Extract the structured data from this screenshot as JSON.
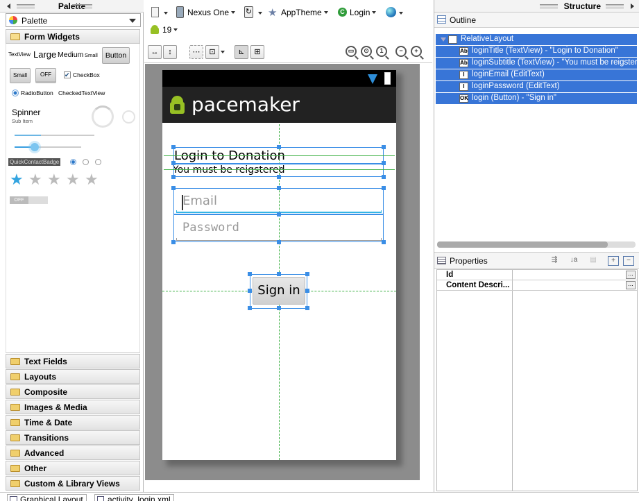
{
  "palette": {
    "title": "Palette",
    "selector_label": "Palette",
    "section_open": "Form Widgets",
    "widgets": {
      "textview_label": "TextView",
      "large_label": "Large",
      "medium_label": "Medium",
      "small_label": "Small",
      "button_label": "Button",
      "small_button_label": "Small",
      "toggle_label": "OFF",
      "checkbox_label": "CheckBox",
      "radio_label": "RadioButton",
      "checkedtextview_label": "CheckedTextView",
      "spinner_label": "Spinner",
      "spinner_sub": "Sub Item",
      "quickcontact_label": "QuickContactBadge",
      "switch_label": "OFF",
      "seekbar_level": 0.35,
      "rating_stars": 1,
      "rating_total": 5
    },
    "categories": [
      "Text Fields",
      "Layouts",
      "Composite",
      "Images & Media",
      "Time & Date",
      "Transitions",
      "Advanced",
      "Other",
      "Custom & Library Views"
    ]
  },
  "toolbar": {
    "device": "Nexus One",
    "theme": "AppTheme",
    "activity": "Login",
    "api_level": "19"
  },
  "device": {
    "app_title": "pacemaker",
    "login_title": "Login to Donation",
    "login_subtitle": "You must be reigstered",
    "email_hint": "Email",
    "password_hint": "Password",
    "signin_label": "Sign in"
  },
  "structure": {
    "title": "Structure",
    "outline_label": "Outline",
    "tree": [
      {
        "icon": "",
        "text": "RelativeLayout"
      },
      {
        "icon": "Ab",
        "text": "loginTitle (TextView) - \"Login to Donation\""
      },
      {
        "icon": "Ab",
        "text": "loginSubtitle (TextView) - \"You must be reigstered\""
      },
      {
        "icon": "I",
        "text": "loginEmail (EditText)"
      },
      {
        "icon": "I",
        "text": "loginPassword (EditText)"
      },
      {
        "icon": "OK",
        "text": "login (Button) - \"Sign in\""
      }
    ]
  },
  "properties": {
    "title": "Properties",
    "rows": [
      {
        "name": "Id"
      },
      {
        "name": "Content Descri..."
      }
    ]
  },
  "bottom_tabs": [
    "Graphical Layout",
    "activity_login.xml"
  ],
  "colors": {
    "selection": "#3875d7",
    "guide": "#3cb043",
    "handle": "#3a8ee6",
    "action_bar": "#222222"
  }
}
